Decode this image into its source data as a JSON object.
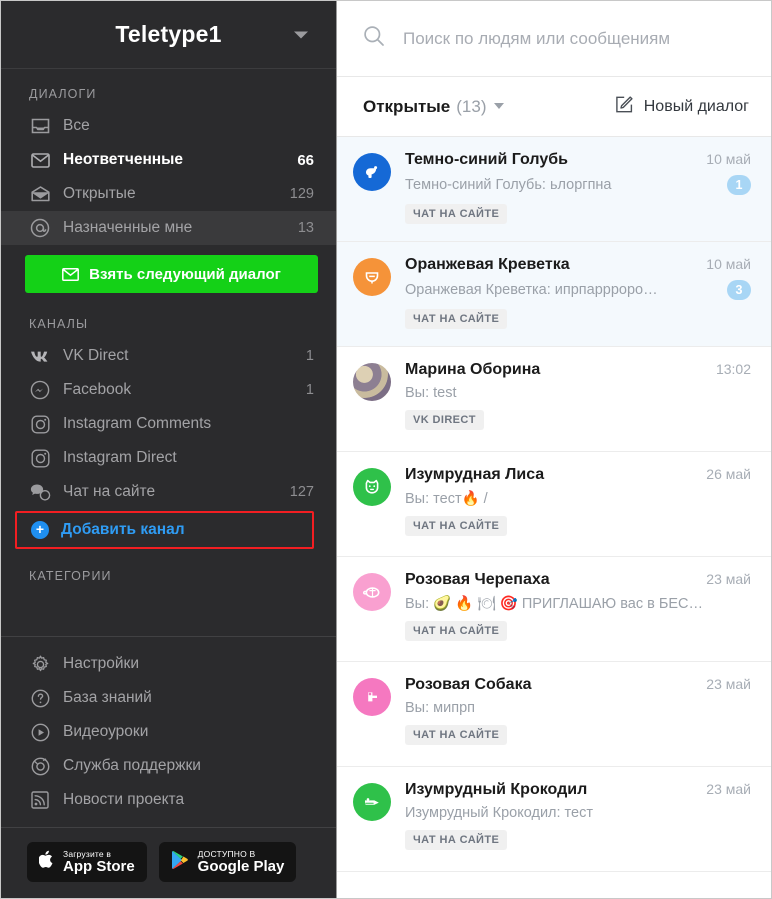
{
  "sidebar": {
    "title": "Teletype1",
    "dialogs_section_label": "ДИАЛОГИ",
    "dialog_items": [
      {
        "label": "Все",
        "count": "",
        "icon": "inbox-icon"
      },
      {
        "label": "Неответченные",
        "count": "66",
        "icon": "envelope-closed-icon"
      },
      {
        "label": "Открытые",
        "count": "129",
        "icon": "envelope-open-icon"
      },
      {
        "label": "Назначенные мне",
        "count": "13",
        "icon": "at-sign-icon"
      }
    ],
    "take_next_button": "Взять следующий диалог",
    "channels_section_label": "КАНАЛЫ",
    "channel_items": [
      {
        "label": "VK Direct",
        "count": "1",
        "icon": "vk-icon"
      },
      {
        "label": "Facebook",
        "count": "1",
        "icon": "messenger-icon"
      },
      {
        "label": "Instagram Comments",
        "count": "",
        "icon": "instagram-icon"
      },
      {
        "label": "Instagram Direct",
        "count": "",
        "icon": "instagram-icon"
      },
      {
        "label": "Чат на сайте",
        "count": "127",
        "icon": "chat-bubble-icon"
      }
    ],
    "add_channel_label": "Добавить канал",
    "categories_section_label": "КАТЕГОРИИ",
    "footer_items": [
      {
        "label": "Настройки",
        "icon": "gear-icon"
      },
      {
        "label": "База знаний",
        "icon": "question-circle-icon"
      },
      {
        "label": "Видеоуроки",
        "icon": "play-circle-icon"
      },
      {
        "label": "Служба поддержки",
        "icon": "lifebuoy-icon"
      },
      {
        "label": "Новости проекта",
        "icon": "rss-icon"
      }
    ],
    "app_store": {
      "small": "Загрузите в",
      "big": "App Store",
      "icon": "apple-icon"
    },
    "google_play": {
      "small": "ДОСТУПНО В",
      "big": "Google Play",
      "icon": "google-play-icon"
    }
  },
  "search": {
    "placeholder": "Поиск по людям или сообщениям",
    "value": "",
    "icon": "search-icon"
  },
  "filter": {
    "name": "Открытые",
    "count": "(13)",
    "new_dialog_label": "Новый диалог",
    "new_dialog_icon": "compose-icon"
  },
  "dialogs": [
    {
      "name": "Темно-синий Голубь",
      "time": "10 май",
      "preview": "Темно-синий Голубь: ьлоргпна",
      "badge": "1",
      "channel_tag": "ЧАТ НА САЙТЕ",
      "avatar_color": "#1569d6",
      "avatar_icon": "bird-icon",
      "unread": true
    },
    {
      "name": "Оранжевая Креветка",
      "time": "10 май",
      "preview": "Оранжевая Креветка: ипрпаррроро…",
      "badge": "3",
      "channel_tag": "ЧАТ НА САЙТЕ",
      "avatar_color": "#f59339",
      "avatar_icon": "shrimp-icon",
      "unread": true
    },
    {
      "name": "Марина Оборина",
      "time": "13:02",
      "preview": "Вы: test",
      "badge": "",
      "channel_tag": "VK DIRECT",
      "avatar_color": "#8c7a8e",
      "avatar_icon": "photo-avatar",
      "unread": false
    },
    {
      "name": "Изумрудная Лиса",
      "time": "26 май",
      "preview": "Вы: тест🔥 /",
      "badge": "",
      "channel_tag": "ЧАТ НА САЙТЕ",
      "avatar_color": "#2fc14a",
      "avatar_icon": "fox-icon",
      "unread": false
    },
    {
      "name": "Розовая Черепаха",
      "time": "23 май",
      "preview": "Вы: 🥑 🔥 🍽 🎯 ПРИГЛАШАЮ вас в БЕС…",
      "badge": "",
      "channel_tag": "ЧАТ НА САЙТЕ",
      "avatar_color": "#f9a0d0",
      "avatar_icon": "turtle-icon",
      "unread": false
    },
    {
      "name": "Розовая Собака",
      "time": "23 май",
      "preview": "Вы: мипрп",
      "badge": "",
      "channel_tag": "ЧАТ НА САЙТЕ",
      "avatar_color": "#f578c0",
      "avatar_icon": "dog-icon",
      "unread": false
    },
    {
      "name": "Изумрудный Крокодил",
      "time": "23 май",
      "preview": "Изумрудный Крокодил: тест",
      "badge": "",
      "channel_tag": "ЧАТ НА САЙТЕ",
      "avatar_color": "#2fc14a",
      "avatar_icon": "crocodile-icon",
      "unread": false
    }
  ],
  "colors": {
    "sidebar_bg": "#2b2b2d",
    "accent_green": "#14d117",
    "accent_blue": "#2f9cf4",
    "highlight_red": "#f31e22",
    "badge_blue": "#a8d6f5",
    "unread_row_bg": "#f4f9fd"
  }
}
